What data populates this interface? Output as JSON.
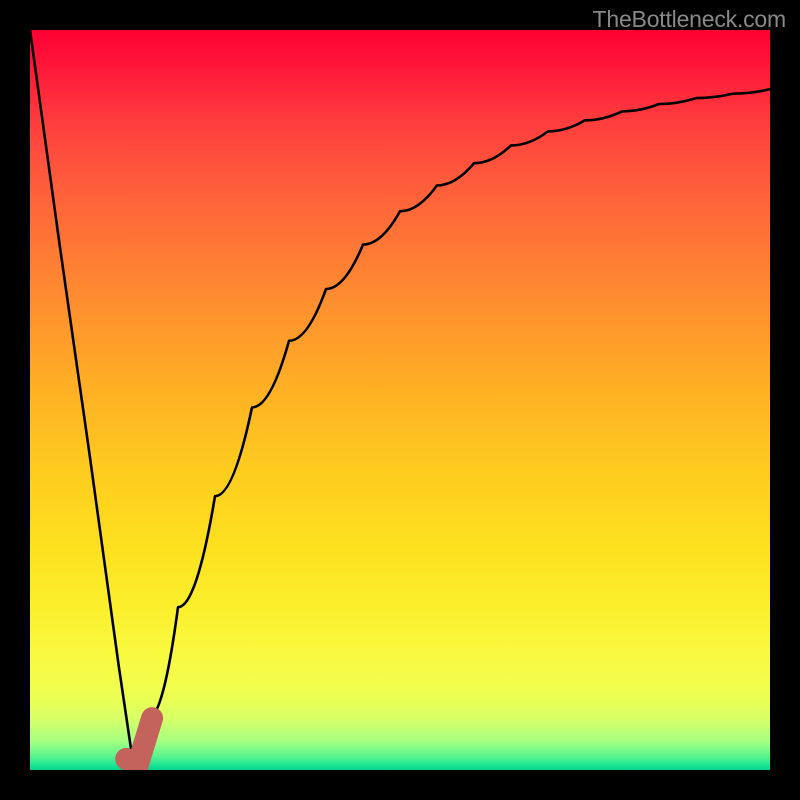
{
  "watermark": "TheBottleneck.com",
  "colors": {
    "background": "#000000",
    "watermark_text": "#888888",
    "curve": "#000000",
    "marker": "#c4635c"
  },
  "chart_data": {
    "type": "line",
    "title": "",
    "xlabel": "",
    "ylabel": "",
    "xlim": [
      0,
      100
    ],
    "ylim": [
      0,
      100
    ],
    "notes": "V-shaped bottleneck curve: steep linear descent from upper-left to a minimum near x≈14, then asymptotic rise toward ~92% at the right edge. A short red J-shaped marker sits at the trough.",
    "series": [
      {
        "name": "bottleneck-curve",
        "x": [
          0,
          4,
          8,
          12,
          14,
          16,
          20,
          25,
          30,
          35,
          40,
          45,
          50,
          55,
          60,
          65,
          70,
          75,
          80,
          85,
          90,
          95,
          100
        ],
        "y": [
          100,
          71,
          43,
          14,
          0.5,
          7,
          22,
          37,
          49,
          58,
          65,
          71,
          75.5,
          79,
          82,
          84.4,
          86.3,
          87.8,
          89,
          90,
          90.8,
          91.4,
          92
        ]
      }
    ],
    "marker": {
      "name": "trough-marker",
      "x": [
        13,
        14.5,
        16.5
      ],
      "y": [
        1.5,
        0.5,
        7
      ]
    },
    "gradient_stops": [
      {
        "pos": 0,
        "color": "#ff0033"
      },
      {
        "pos": 50,
        "color": "#ffb423"
      },
      {
        "pos": 84,
        "color": "#f9f93f"
      },
      {
        "pos": 100,
        "color": "#05d38e"
      }
    ]
  }
}
